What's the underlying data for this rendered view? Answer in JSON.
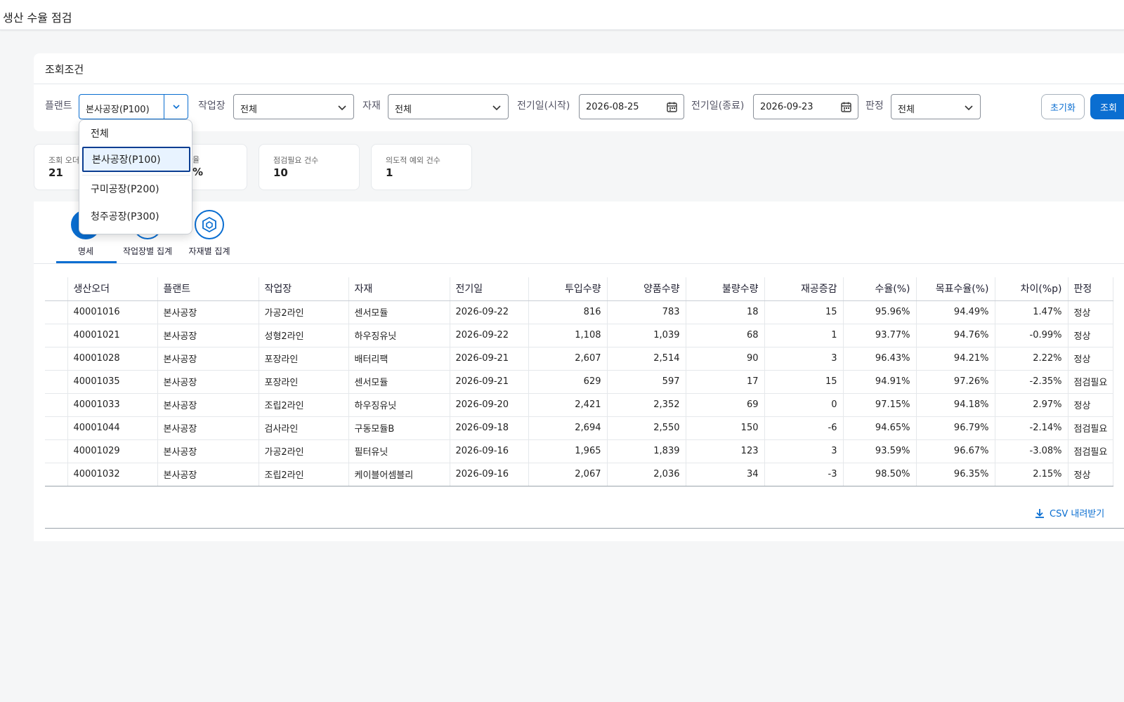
{
  "page": {
    "title": "생산 수율 점검"
  },
  "filter": {
    "title": "조회조건",
    "plant": {
      "label": "플랜트",
      "value": "본사공장(P100)"
    },
    "workcenter": {
      "label": "작업장",
      "value": "전체"
    },
    "material": {
      "label": "자재",
      "value": "전체"
    },
    "date_from": {
      "label": "전기일(시작)",
      "value": "2026-08-25"
    },
    "date_to": {
      "label": "전기일(종료)",
      "value": "2026-09-23"
    },
    "judgment": {
      "label": "판정",
      "value": "전체"
    },
    "reset_label": "초기화",
    "search_label": "조회"
  },
  "kpis": [
    {
      "label": "조회 오더",
      "value": "21"
    },
    {
      "label": "율",
      "value": "%"
    },
    {
      "label": "점검필요 건수",
      "value": "10"
    },
    {
      "label": "의도적 예외 건수",
      "value": "1"
    }
  ],
  "tabs": [
    {
      "label": "명세",
      "icon": "list-icon",
      "active": true
    },
    {
      "label": "작업장별 집계",
      "icon": "workcenter-icon",
      "active": false
    },
    {
      "label": "자재별 집계",
      "icon": "cube-icon",
      "active": false
    }
  ],
  "table": {
    "columns": [
      "생산오더",
      "플랜트",
      "작업장",
      "자재",
      "전기일",
      "투입수량",
      "양품수량",
      "불량수량",
      "재공증감",
      "수율(%)",
      "목표수율(%)",
      "차이(%p)",
      "판정"
    ],
    "rows": [
      [
        "40001016",
        "본사공장",
        "가공2라인",
        "센서모듈",
        "2026-09-22",
        "816",
        "783",
        "18",
        "15",
        "95.96%",
        "94.49%",
        "1.47%",
        "정상"
      ],
      [
        "40001021",
        "본사공장",
        "성형2라인",
        "하우징유닛",
        "2026-09-22",
        "1,108",
        "1,039",
        "68",
        "1",
        "93.77%",
        "94.76%",
        "-0.99%",
        "정상"
      ],
      [
        "40001028",
        "본사공장",
        "포장라인",
        "배터리팩",
        "2026-09-21",
        "2,607",
        "2,514",
        "90",
        "3",
        "96.43%",
        "94.21%",
        "2.22%",
        "정상"
      ],
      [
        "40001035",
        "본사공장",
        "포장라인",
        "센서모듈",
        "2026-09-21",
        "629",
        "597",
        "17",
        "15",
        "94.91%",
        "97.26%",
        "-2.35%",
        "점검필요"
      ],
      [
        "40001033",
        "본사공장",
        "조립2라인",
        "하우징유닛",
        "2026-09-20",
        "2,421",
        "2,352",
        "69",
        "0",
        "97.15%",
        "94.18%",
        "2.97%",
        "정상"
      ],
      [
        "40001044",
        "본사공장",
        "검사라인",
        "구동모듈B",
        "2026-09-18",
        "2,694",
        "2,550",
        "150",
        "-6",
        "94.65%",
        "96.79%",
        "-2.14%",
        "점검필요"
      ],
      [
        "40001029",
        "본사공장",
        "가공2라인",
        "필터유닛",
        "2026-09-16",
        "1,965",
        "1,839",
        "123",
        "3",
        "93.59%",
        "96.67%",
        "-3.08%",
        "점검필요"
      ],
      [
        "40001032",
        "본사공장",
        "조립2라인",
        "케이블어셈블리",
        "2026-09-16",
        "2,067",
        "2,036",
        "34",
        "-3",
        "98.50%",
        "96.35%",
        "2.15%",
        "정상"
      ]
    ]
  },
  "csv_label": "CSV 내려받기",
  "dropdown": {
    "options": [
      "전체",
      "본사공장(P100)",
      "구미공장(P200)",
      "청주공장(P300)"
    ],
    "selected_index": 1
  },
  "colors": {
    "accent": "#0a6ed1",
    "ok": "#2b7d2b",
    "warn": "#c35500"
  }
}
